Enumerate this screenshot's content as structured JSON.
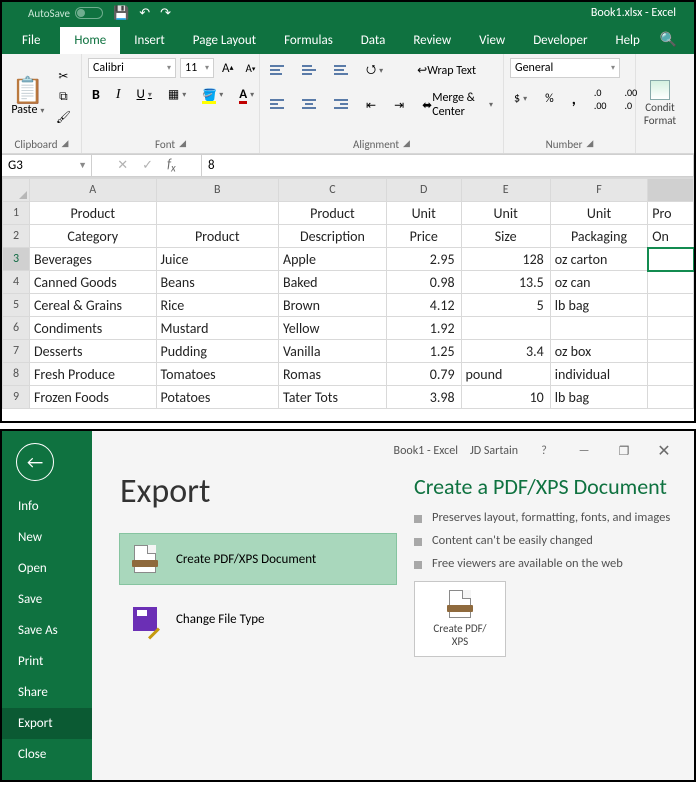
{
  "colors": {
    "brand": "#0f7240"
  },
  "titlebar": {
    "autosave": "AutoSave",
    "doc": "Book1.xlsx - Excel"
  },
  "tabs": [
    "File",
    "Home",
    "Insert",
    "Page Layout",
    "Formulas",
    "Data",
    "Review",
    "View",
    "Developer",
    "Help"
  ],
  "active_tab": "Home",
  "ribbon": {
    "clipboard": {
      "paste": "Paste",
      "label": "Clipboard"
    },
    "font": {
      "name": "Calibri",
      "size": "11",
      "label": "Font"
    },
    "alignment": {
      "wrap": "Wrap Text",
      "merge": "Merge & Center",
      "label": "Alignment"
    },
    "number": {
      "format": "General",
      "label": "Number"
    },
    "styles": {
      "cond": "Condit\nFormat"
    }
  },
  "fx": {
    "namebox": "G3",
    "value": "8"
  },
  "chart_data": {
    "type": "table",
    "columns_row1": [
      "Product",
      "",
      "Product",
      "Unit",
      "Unit",
      "Unit",
      "Pro"
    ],
    "columns_row2": [
      "Category",
      "Product",
      "Description",
      "Price",
      "Size",
      "Packaging",
      "On"
    ],
    "rows": [
      {
        "n": 3,
        "cat": "Beverages",
        "prod": "Juice",
        "desc": "Apple",
        "price": "2.95",
        "size": "128",
        "pack": "oz carton"
      },
      {
        "n": 4,
        "cat": "Canned Goods",
        "prod": "Beans",
        "desc": "Baked",
        "price": "0.98",
        "size": "13.5",
        "pack": "oz can"
      },
      {
        "n": 5,
        "cat": "Cereal & Grains",
        "prod": "Rice",
        "desc": "Brown",
        "price": "4.12",
        "size": "5",
        "pack": "lb bag"
      },
      {
        "n": 6,
        "cat": "Condiments",
        "prod": "Mustard",
        "desc": "Yellow",
        "price": "1.92",
        "size": "",
        "pack": ""
      },
      {
        "n": 7,
        "cat": "Desserts",
        "prod": "Pudding",
        "desc": "Vanilla",
        "price": "1.25",
        "size": "3.4",
        "pack": "oz box"
      },
      {
        "n": 8,
        "cat": "Fresh Produce",
        "prod": "Tomatoes",
        "desc": "Romas",
        "price": "0.79",
        "size": "pound",
        "pack": "individual"
      },
      {
        "n": 9,
        "cat": "Frozen Foods",
        "prod": "Potatoes",
        "desc": "Tater Tots",
        "price": "3.98",
        "size": "10",
        "pack": "lb bag"
      }
    ],
    "col_letters": [
      "A",
      "B",
      "C",
      "D",
      "E",
      "F"
    ],
    "active_cell": "G3"
  },
  "backstage": {
    "title": {
      "doc": "Book1  -  Excel",
      "user": "JD Sartain"
    },
    "nav": [
      "Info",
      "New",
      "Open",
      "Save",
      "Save As",
      "Print",
      "Share",
      "Export",
      "Close"
    ],
    "active_nav": "Export",
    "heading": "Export",
    "options": {
      "pdf": "Create PDF/XPS Document",
      "change": "Change File Type"
    },
    "right": {
      "heading": "Create a PDF/XPS Document",
      "bullets": [
        "Preserves layout, formatting, fonts, and images",
        "Content can't be easily changed",
        "Free viewers are available on the web"
      ],
      "button": "Create PDF/\nXPS"
    }
  }
}
